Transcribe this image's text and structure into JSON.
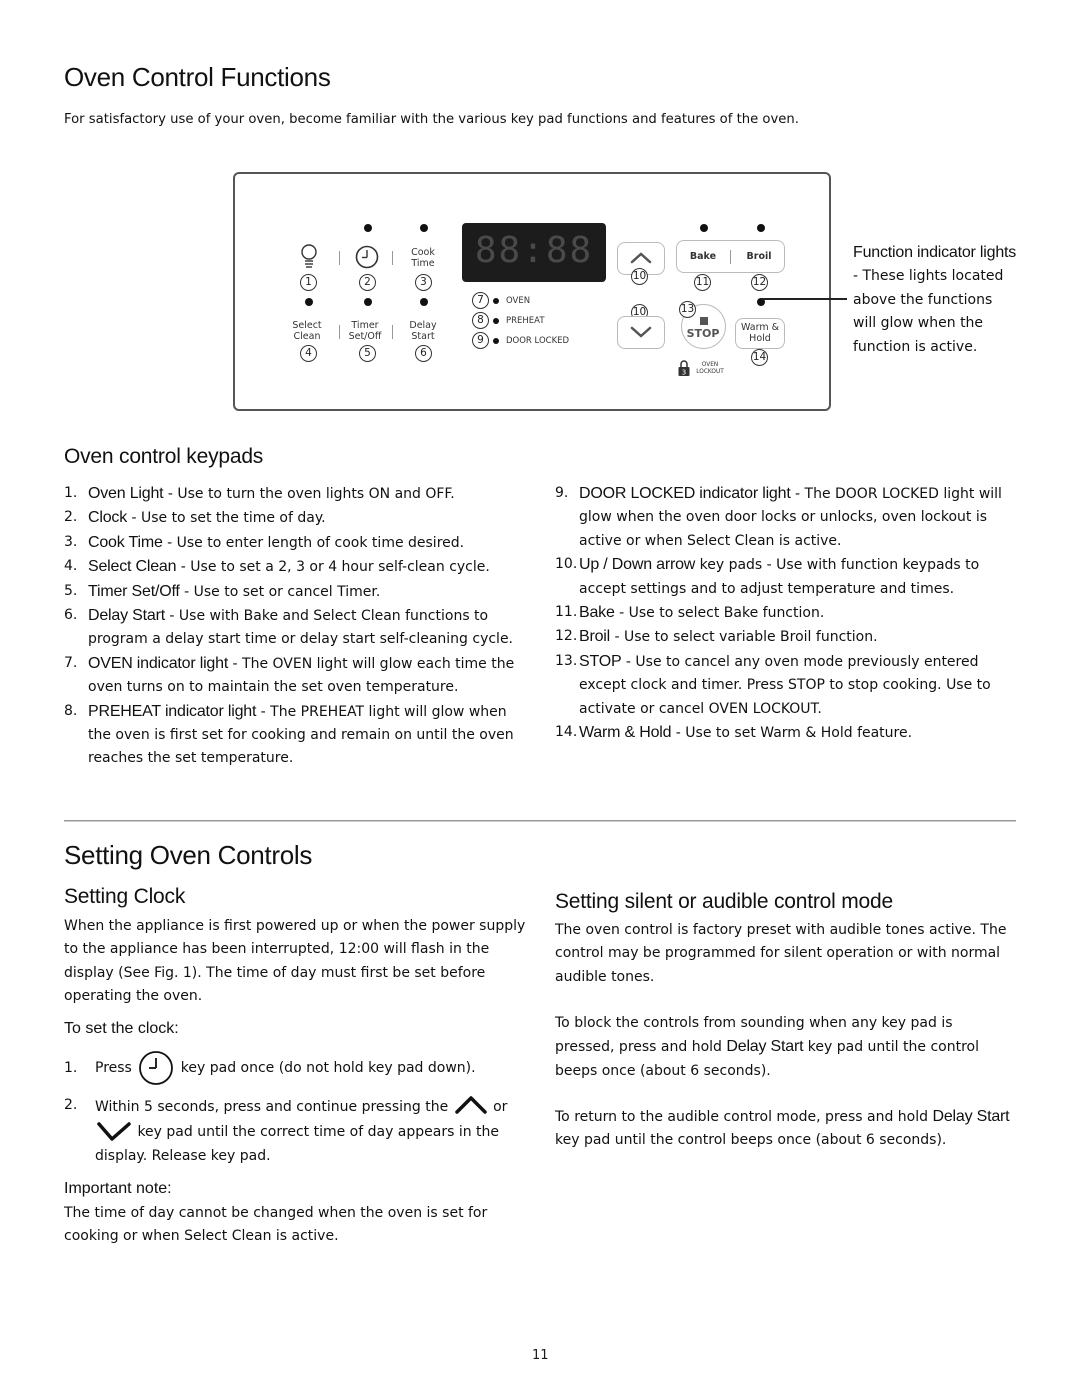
{
  "page": {
    "title": "Oven Control Functions",
    "intro": "For satisfactory use of your oven, become familiar with the various key pad functions and features of the oven.",
    "page_number": "11"
  },
  "diagram": {
    "keys_left": [
      {
        "num": "1",
        "label": "",
        "icon": "light-bulb-icon"
      },
      {
        "num": "2",
        "label": "",
        "icon": "clock-icon"
      },
      {
        "num": "3",
        "label": "Cook\nTime"
      },
      {
        "num": "4",
        "label": "Select\nClean"
      },
      {
        "num": "5",
        "label": "Timer\nSet/Off"
      },
      {
        "num": "6",
        "label": "Delay\nStart"
      }
    ],
    "display_text": "88:88",
    "indicators": [
      {
        "num": "7",
        "label": "OVEN"
      },
      {
        "num": "8",
        "label": "PREHEAT"
      },
      {
        "num": "9",
        "label": "DOOR LOCKED"
      }
    ],
    "up_num": "10",
    "down_num": "10",
    "bake_label": "Bake",
    "bake_num": "11",
    "broil_label": "Broil",
    "broil_num": "12",
    "stop_label": "STOP",
    "stop_num": "13",
    "warm_label": "Warm &\nHold",
    "warm_num": "14",
    "lockout_badge": "3",
    "lockout_label": "OVEN\nLOCKOUT",
    "callout_title": "Function indicator lights",
    "callout_text": " - These lights located above the functions will glow when the function is active."
  },
  "keypads": {
    "heading": "Oven control keypads",
    "items": [
      {
        "n": "1.",
        "term": "Oven Light",
        "desc": " - Use to turn the oven lights ON and OFF."
      },
      {
        "n": "2.",
        "term": "Clock",
        "desc": " - Use to set the time of day."
      },
      {
        "n": "3.",
        "term": "Cook Time",
        "desc": " - Use to enter length of cook time desired."
      },
      {
        "n": "4.",
        "term": "Select Clean",
        "desc": " - Use to set a 2, 3 or 4 hour self-clean cycle."
      },
      {
        "n": "5.",
        "term": "Timer Set/Off",
        "desc": " - Use to set or cancel Timer."
      },
      {
        "n": "6.",
        "term": "Delay Start",
        "desc": " - Use with Bake and Select Clean functions to program a delay start time or delay start self-cleaning cycle."
      },
      {
        "n": "7.",
        "term": "OVEN indicator light",
        "desc": " - The OVEN light will glow each time the oven turns on to maintain the set oven temperature."
      },
      {
        "n": "8.",
        "term": "PREHEAT indicator light",
        "desc": " - The PREHEAT light will glow when the oven is first set for cooking and remain on until the oven reaches the set temperature."
      },
      {
        "n": "9.",
        "term": "DOOR LOCKED indicator light",
        "desc": " - The DOOR LOCKED light will glow when the oven door locks or unlocks, oven lockout is active or when Select Clean is active."
      },
      {
        "n": "10.",
        "term": "Up / Down arrow",
        "desc": " key pads - Use with function keypads to accept settings and to adjust temperature and times."
      },
      {
        "n": "11.",
        "term": "Bake",
        "desc": " - Use to select Bake function."
      },
      {
        "n": "12.",
        "term": "Broil",
        "desc": " - Use to select variable Broil function."
      },
      {
        "n": "13.",
        "term": "STOP",
        "desc": " - Use to cancel any oven mode previously entered except clock and timer. Press STOP to stop cooking. Use to activate or cancel OVEN LOCKOUT."
      },
      {
        "n": "14.",
        "term": "Warm & Hold",
        "desc": " - Use to set Warm & Hold feature."
      }
    ]
  },
  "setting": {
    "heading": "Setting Oven Controls",
    "clock": {
      "heading": "Setting Clock",
      "para": "When the appliance is first powered up or when the power supply to the appliance has been interrupted, 12:00 will flash in the display (See Fig. 1). The time of day must first be set before operating the oven.",
      "subheading": "To set the clock:",
      "step1_n": "1.",
      "step1_pre": "Press",
      "step1_post": "key pad once (do not hold key pad down).",
      "step2_n": "2.",
      "step2_a": "Within 5 seconds, press and continue pressing the",
      "step2_b": "or",
      "step2_c": "key pad until the correct time of day appears in the display. Release key pad.",
      "note_heading": "Important note:",
      "note": "The time of day cannot be changed when the oven is set for cooking or when Select Clean is active."
    },
    "silent": {
      "heading": "Setting silent or audible control mode",
      "p1": "The oven control is factory preset with audible tones active. The control may be programmed for silent operation or with normal audible tones.",
      "p2_a": "To block the controls from sounding when any key pad is pressed, press and hold ",
      "p2_kw": "Delay Start",
      "p2_b": " key pad until the control beeps once (about 6 seconds).",
      "p3_a": "To return to the audible control mode, press and hold ",
      "p3_kw": "Delay Start",
      "p3_b": " key pad until the control beeps once (about 6 seconds)."
    }
  }
}
